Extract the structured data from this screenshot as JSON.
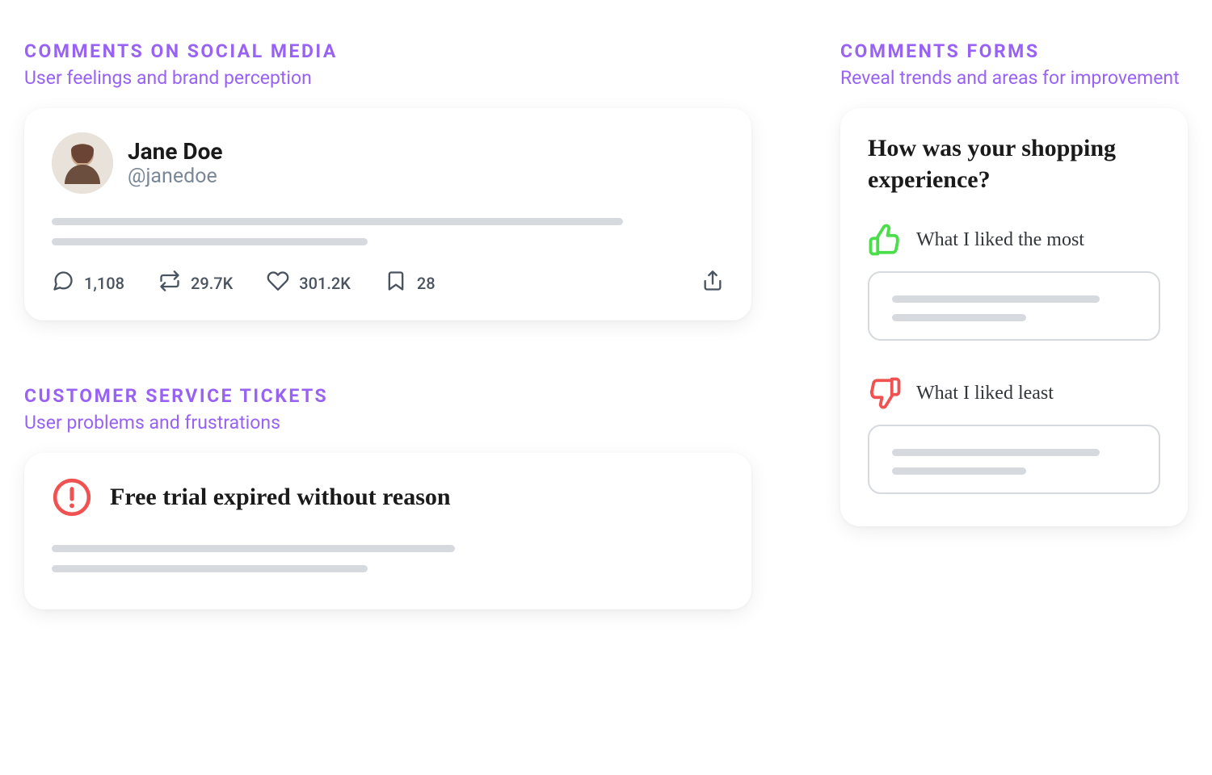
{
  "sections": {
    "social": {
      "heading": "COMMENTS ON SOCIAL MEDIA",
      "sub": "User feelings and brand perception"
    },
    "tickets": {
      "heading": "CUSTOMER SERVICE TICKETS",
      "sub": "User problems and frustrations"
    },
    "forms": {
      "heading": "COMMENTS FORMS",
      "sub": "Reveal trends and areas for improvement"
    }
  },
  "tweet": {
    "user_name": "Jane Doe",
    "user_handle": "@janedoe",
    "reply_count": "1,108",
    "retweet_count": "29.7K",
    "like_count": "301.2K",
    "bookmark_count": "28"
  },
  "ticket": {
    "title": "Free trial expired without reason"
  },
  "form": {
    "question": "How was your shopping experience?",
    "like_label": "What I liked the most",
    "dislike_label": "What I liked least"
  }
}
